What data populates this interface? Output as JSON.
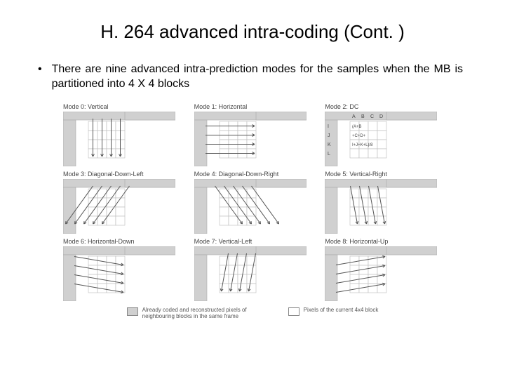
{
  "title": "H. 264 advanced intra-coding (Cont. )",
  "bullet": "There are nine advanced intra-prediction modes for the samples when the MB is partitioned into 4 X 4 blocks",
  "modes": [
    {
      "label": "Mode 0: Vertical",
      "type": "vertical"
    },
    {
      "label": "Mode 1: Horizontal",
      "type": "horizontal"
    },
    {
      "label": "Mode 2: DC",
      "type": "dc"
    },
    {
      "label": "Mode 3: Diagonal-Down-Left",
      "type": "ddl"
    },
    {
      "label": "Mode 4: Diagonal-Down-Right",
      "type": "ddr"
    },
    {
      "label": "Mode 5: Vertical-Right",
      "type": "vr"
    },
    {
      "label": "Mode 6: Horizontal-Down",
      "type": "hd"
    },
    {
      "label": "Mode 7: Vertical-Left",
      "type": "vl"
    },
    {
      "label": "Mode 8: Horizontal-Up",
      "type": "hu"
    }
  ],
  "dc_labels": {
    "top": [
      "A",
      "B",
      "C",
      "D"
    ],
    "left": [
      "I",
      "J",
      "K",
      "L"
    ],
    "rows": [
      "(A+B",
      "+C+D+",
      "I+J+K+L)/8",
      ""
    ]
  },
  "legend": {
    "coded": "Already coded and reconstructed pixels of neighbouring blocks in the same frame",
    "current": "Pixels of the current 4x4 block"
  }
}
